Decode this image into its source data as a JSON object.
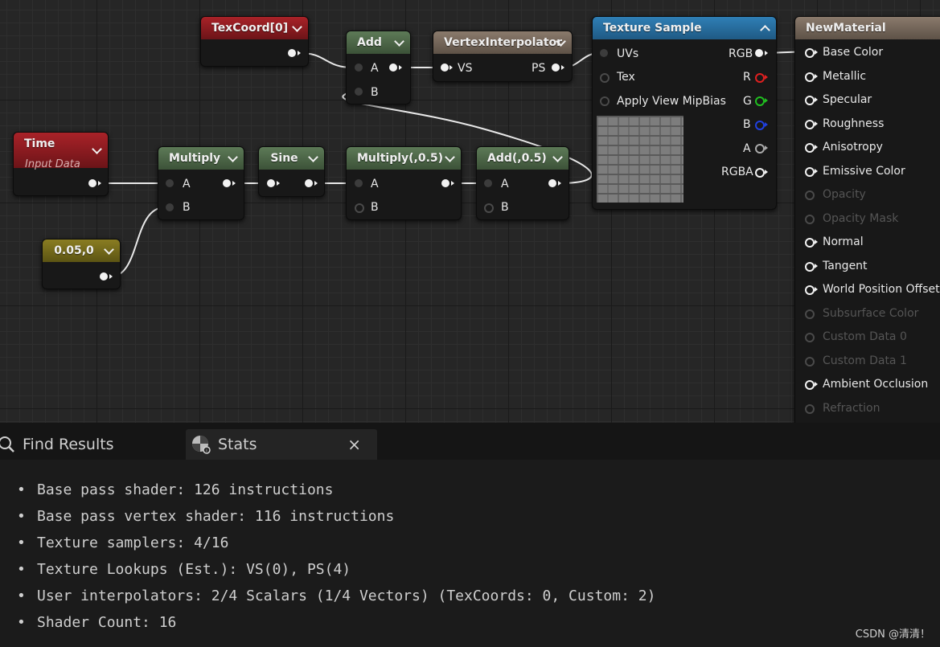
{
  "colors": {
    "graph_bg": "#262626",
    "param_red": "#a92228",
    "math_green": "#5d7a57",
    "utility_brown": "#8a7a6c",
    "texture_blue": "#2f7fb6",
    "constant_yellow": "#8a7d22",
    "pin_r": "#e02020",
    "pin_g": "#20c020",
    "pin_b": "#2040e0"
  },
  "nodes": {
    "texcoord": {
      "title": "TexCoord[0]"
    },
    "add": {
      "title": "Add",
      "pin_a": "A",
      "pin_b": "B"
    },
    "vertex_interpolator": {
      "title": "VertexInterpolator",
      "pin_in": "VS",
      "pin_out": "PS"
    },
    "time": {
      "title": "Time",
      "subtitle": "Input Data"
    },
    "multiply": {
      "title": "Multiply",
      "pin_a": "A",
      "pin_b": "B"
    },
    "sine": {
      "title": "Sine"
    },
    "multiply_half": {
      "title": "Multiply(,0.5)",
      "pin_a": "A",
      "pin_b": "B"
    },
    "add_half": {
      "title": "Add(,0.5)",
      "pin_a": "A",
      "pin_b": "B"
    },
    "constant": {
      "title": "0.05,0"
    },
    "texture_sample": {
      "title": "Texture Sample",
      "inputs": [
        "UVs",
        "Tex",
        "Apply View MipBias"
      ],
      "outputs": [
        "RGB",
        "R",
        "G",
        "B",
        "A",
        "RGBA"
      ],
      "thumbnail": "stone-brick-texture"
    },
    "material": {
      "title": "NewMaterial",
      "inputs": [
        {
          "label": "Base Color",
          "enabled": true
        },
        {
          "label": "Metallic",
          "enabled": true
        },
        {
          "label": "Specular",
          "enabled": true
        },
        {
          "label": "Roughness",
          "enabled": true
        },
        {
          "label": "Anisotropy",
          "enabled": true
        },
        {
          "label": "Emissive Color",
          "enabled": true
        },
        {
          "label": "Opacity",
          "enabled": false
        },
        {
          "label": "Opacity Mask",
          "enabled": false
        },
        {
          "label": "Normal",
          "enabled": true
        },
        {
          "label": "Tangent",
          "enabled": true
        },
        {
          "label": "World Position Offset",
          "enabled": true
        },
        {
          "label": "Subsurface Color",
          "enabled": false
        },
        {
          "label": "Custom Data 0",
          "enabled": false
        },
        {
          "label": "Custom Data 1",
          "enabled": false
        },
        {
          "label": "Ambient Occlusion",
          "enabled": true
        },
        {
          "label": "Refraction",
          "enabled": false
        }
      ]
    }
  },
  "tabs": {
    "find_results": {
      "label": "Find Results",
      "icon": "search-icon"
    },
    "stats": {
      "label": "Stats",
      "icon": "checker-sphere-icon",
      "close": "×"
    }
  },
  "stats": [
    "Base pass shader: 126 instructions",
    "Base pass vertex shader: 116 instructions",
    "Texture samplers: 4/16",
    "Texture Lookups (Est.): VS(0), PS(4)",
    "User interpolators: 2/4 Scalars (1/4 Vectors) (TexCoords: 0, Custom: 2)",
    "Shader Count: 16"
  ],
  "watermark": "CSDN @清清！"
}
